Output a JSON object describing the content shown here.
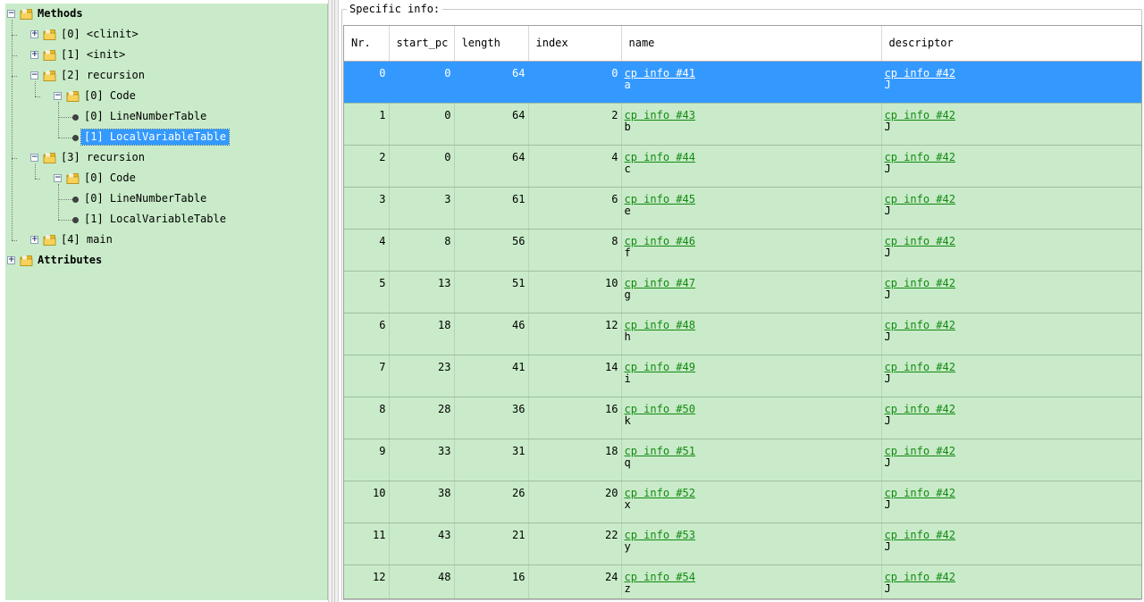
{
  "tree": {
    "nodes": [
      {
        "id": "methods",
        "label": "Methods",
        "depth": 0,
        "kind": "folder",
        "expander": "minus",
        "bold": true
      },
      {
        "id": "m0",
        "label": "[0] <clinit>",
        "depth": 1,
        "kind": "folder",
        "expander": "plus"
      },
      {
        "id": "m1",
        "label": "[1] <init>",
        "depth": 1,
        "kind": "folder",
        "expander": "plus"
      },
      {
        "id": "m2",
        "label": "[2] recursion",
        "depth": 1,
        "kind": "folder",
        "expander": "minus"
      },
      {
        "id": "m2c",
        "label": "[0] Code",
        "depth": 2,
        "kind": "folder",
        "expander": "minus"
      },
      {
        "id": "m2c0",
        "label": "[0] LineNumberTable",
        "depth": 3,
        "kind": "leaf"
      },
      {
        "id": "m2c1",
        "label": "[1] LocalVariableTable",
        "depth": 3,
        "kind": "leaf",
        "selected": true
      },
      {
        "id": "m3",
        "label": "[3] recursion",
        "depth": 1,
        "kind": "folder",
        "expander": "minus"
      },
      {
        "id": "m3c",
        "label": "[0] Code",
        "depth": 2,
        "kind": "folder",
        "expander": "minus"
      },
      {
        "id": "m3c0",
        "label": "[0] LineNumberTable",
        "depth": 3,
        "kind": "leaf"
      },
      {
        "id": "m3c1",
        "label": "[1] LocalVariableTable",
        "depth": 3,
        "kind": "leaf"
      },
      {
        "id": "m4",
        "label": "[4] main",
        "depth": 1,
        "kind": "folder",
        "expander": "plus"
      },
      {
        "id": "attributes",
        "label": "Attributes",
        "depth": 0,
        "kind": "folder",
        "expander": "plus",
        "bold": true
      }
    ]
  },
  "panel": {
    "title": "Specific info:"
  },
  "table": {
    "columns": [
      "Nr.",
      "start_pc",
      "length",
      "index",
      "name",
      "descriptor"
    ],
    "selected_row": 0,
    "rows": [
      {
        "nr": "0",
        "start_pc": "0",
        "length": "64",
        "index": "0",
        "name_link": "cp info #41",
        "name_val": "a",
        "desc_link": "cp info #42",
        "desc_val": "J"
      },
      {
        "nr": "1",
        "start_pc": "0",
        "length": "64",
        "index": "2",
        "name_link": "cp info #43",
        "name_val": "b",
        "desc_link": "cp info #42",
        "desc_val": "J"
      },
      {
        "nr": "2",
        "start_pc": "0",
        "length": "64",
        "index": "4",
        "name_link": "cp info #44",
        "name_val": "c",
        "desc_link": "cp info #42",
        "desc_val": "J"
      },
      {
        "nr": "3",
        "start_pc": "3",
        "length": "61",
        "index": "6",
        "name_link": "cp info #45",
        "name_val": "e",
        "desc_link": "cp info #42",
        "desc_val": "J"
      },
      {
        "nr": "4",
        "start_pc": "8",
        "length": "56",
        "index": "8",
        "name_link": "cp info #46",
        "name_val": "f",
        "desc_link": "cp info #42",
        "desc_val": "J"
      },
      {
        "nr": "5",
        "start_pc": "13",
        "length": "51",
        "index": "10",
        "name_link": "cp info #47",
        "name_val": "g",
        "desc_link": "cp info #42",
        "desc_val": "J"
      },
      {
        "nr": "6",
        "start_pc": "18",
        "length": "46",
        "index": "12",
        "name_link": "cp info #48",
        "name_val": "h",
        "desc_link": "cp info #42",
        "desc_val": "J"
      },
      {
        "nr": "7",
        "start_pc": "23",
        "length": "41",
        "index": "14",
        "name_link": "cp info #49",
        "name_val": "i",
        "desc_link": "cp info #42",
        "desc_val": "J"
      },
      {
        "nr": "8",
        "start_pc": "28",
        "length": "36",
        "index": "16",
        "name_link": "cp info #50",
        "name_val": "k",
        "desc_link": "cp info #42",
        "desc_val": "J"
      },
      {
        "nr": "9",
        "start_pc": "33",
        "length": "31",
        "index": "18",
        "name_link": "cp info #51",
        "name_val": "q",
        "desc_link": "cp info #42",
        "desc_val": "J"
      },
      {
        "nr": "10",
        "start_pc": "38",
        "length": "26",
        "index": "20",
        "name_link": "cp info #52",
        "name_val": "x",
        "desc_link": "cp info #42",
        "desc_val": "J"
      },
      {
        "nr": "11",
        "start_pc": "43",
        "length": "21",
        "index": "22",
        "name_link": "cp info #53",
        "name_val": "y",
        "desc_link": "cp info #42",
        "desc_val": "J"
      },
      {
        "nr": "12",
        "start_pc": "48",
        "length": "16",
        "index": "24",
        "name_link": "cp info #54",
        "name_val": "z",
        "desc_link": "cp info #42",
        "desc_val": "J"
      }
    ]
  },
  "colors": {
    "pane_green": "#c9ebc9",
    "selection_blue": "#3399ff",
    "link_green": "#128a12",
    "folder_yellow": "#e8b92a"
  },
  "icons": {
    "folder": "folder-icon",
    "leaf": "bullet-icon",
    "expand": "plus-box-icon",
    "collapse": "minus-box-icon"
  }
}
